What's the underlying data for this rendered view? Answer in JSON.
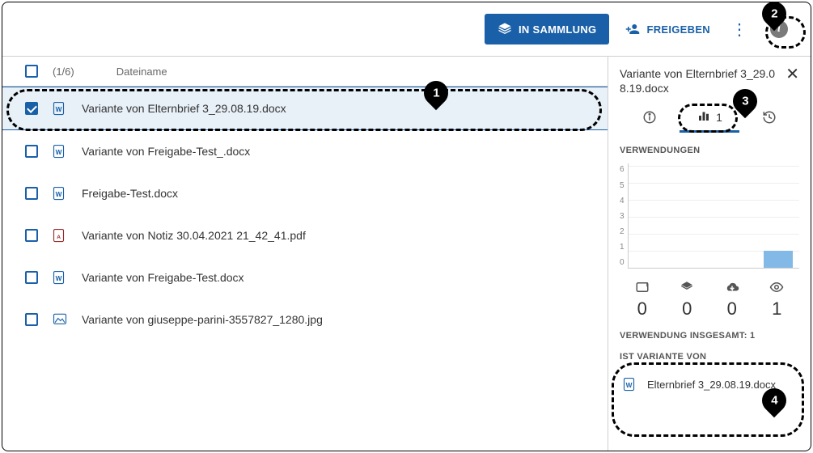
{
  "toolbar": {
    "collection_label": "IN SAMMLUNG",
    "share_label": "FREIGEBEN"
  },
  "list": {
    "count_label": "(1/6)",
    "column_name": "Dateiname",
    "rows": [
      {
        "name": "Variante von Elternbrief 3_29.08.19.docx",
        "type": "word",
        "selected": true
      },
      {
        "name": "Variante von Freigabe-Test_.docx",
        "type": "word",
        "selected": false
      },
      {
        "name": "Freigabe-Test.docx",
        "type": "word",
        "selected": false
      },
      {
        "name": "Variante von Notiz 30.04.2021 21_42_41.pdf",
        "type": "pdf",
        "selected": false
      },
      {
        "name": "Variante von Freigabe-Test.docx",
        "type": "word",
        "selected": false
      },
      {
        "name": "Variante von giuseppe-parini-3557827_1280.jpg",
        "type": "image",
        "selected": false
      }
    ]
  },
  "side": {
    "title": "Variante von Elternbrief 3_29.08.19.docx",
    "tab_stats_count": "1",
    "usage_label": "VERWENDUNGEN",
    "total_label": "VERWENDUNG INSGESAMT: 1",
    "variant_label": "IST VARIANTE VON",
    "variant_file": "Elternbrief 3_29.08.19.docx",
    "stats": {
      "embed": "0",
      "collection": "0",
      "download": "0",
      "view": "1"
    }
  },
  "chart_data": {
    "type": "bar",
    "categories": [
      "embed",
      "collection",
      "download",
      "view"
    ],
    "values": [
      0,
      0,
      0,
      1
    ],
    "title": "VERWENDUNGEN",
    "xlabel": "",
    "ylabel": "",
    "ylim": [
      0,
      6
    ]
  },
  "annotations": {
    "a1": "1",
    "a2": "2",
    "a3": "3",
    "a4": "4"
  },
  "icons": {
    "word_color": "#1a60a8",
    "pdf_color": "#9a2a2a",
    "image_color": "#1a60a8"
  }
}
